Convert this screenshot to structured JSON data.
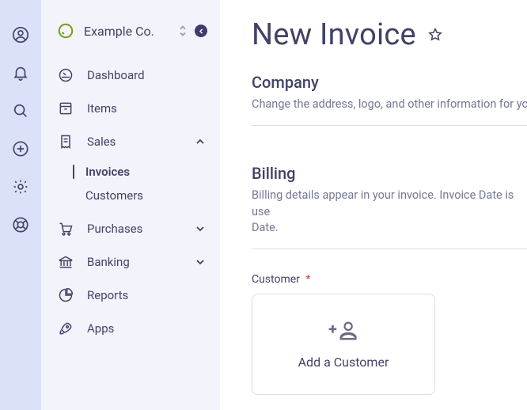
{
  "rail": {
    "items": [
      "account-icon",
      "bell-icon",
      "search-icon",
      "plus-circle-icon",
      "gear-icon",
      "help-icon"
    ]
  },
  "company": {
    "name": "Example Co."
  },
  "nav": {
    "dashboard": "Dashboard",
    "items": "Items",
    "sales": "Sales",
    "invoices": "Invoices",
    "customers": "Customers",
    "purchases": "Purchases",
    "banking": "Banking",
    "reports": "Reports",
    "apps": "Apps"
  },
  "page": {
    "title": "New Invoice"
  },
  "company_section": {
    "heading": "Company",
    "description": "Change the address, logo, and other information for yo"
  },
  "billing_section": {
    "heading": "Billing",
    "description": "Billing details appear in your invoice. Invoice Date is use\nDate."
  },
  "customer_field": {
    "label": "Customer",
    "required": "*",
    "add_label": "Add a Customer"
  }
}
